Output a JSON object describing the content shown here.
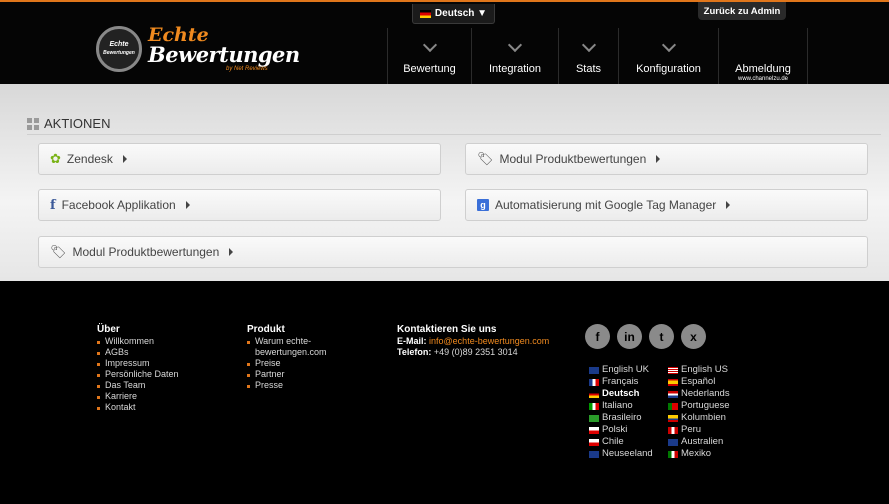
{
  "header": {
    "language_selector": "Deutsch ▼",
    "admin_button": "Zurück zu Admin",
    "logo": {
      "line1": "Echte",
      "line2": "Bewertungen",
      "by": "by Net Reviews",
      "badge_line1": "Echte",
      "badge_line2": "Bewertungen"
    },
    "nav": [
      {
        "label": "Bewertung",
        "icon": "chevron-down-icon"
      },
      {
        "label": "Integration",
        "icon": "chevron-down-icon"
      },
      {
        "label": "Stats",
        "icon": "chevron-down-icon"
      },
      {
        "label": "Konfiguration",
        "icon": "chevron-down-icon"
      },
      {
        "label": "Abmeldung",
        "sub": "www.channelzu.de"
      }
    ]
  },
  "main": {
    "section_title": "AKTIONEN",
    "actions": [
      {
        "label": "Zendesk",
        "icon": "zendesk-gear-icon"
      },
      {
        "label": "Modul Produktbewertungen",
        "icon": "tag-icon"
      },
      {
        "label": "Facebook Applikation",
        "icon": "facebook-icon"
      },
      {
        "label": "Automatisierung mit Google Tag Manager",
        "icon": "google-icon"
      },
      {
        "label": "Modul Produktbewertungen",
        "icon": "tag-icon"
      }
    ]
  },
  "footer": {
    "about": {
      "title": "Über",
      "items": [
        "Willkommen",
        "AGBs",
        "Impressum",
        "Persönliche Daten",
        "Das Team",
        "Karriere",
        "Kontakt"
      ]
    },
    "product": {
      "title": "Produkt",
      "items": [
        "Warum echte-bewertungen.com",
        "Preise",
        "Partner",
        "Presse"
      ]
    },
    "contact": {
      "title": "Kontaktieren Sie uns",
      "email_label": "E-Mail:",
      "email": "info@echte-bewertungen.com",
      "phone_label": "Telefon:",
      "phone": "+49 (0)89 2351 3014"
    },
    "socials": [
      {
        "icon": "facebook-icon",
        "glyph": "f"
      },
      {
        "icon": "linkedin-icon",
        "glyph": "in"
      },
      {
        "icon": "twitter-icon",
        "glyph": "t"
      },
      {
        "icon": "xing-icon",
        "glyph": "x"
      }
    ],
    "languages_left": [
      "English UK",
      "Français",
      "Deutsch",
      "Italiano",
      "Brasileiro",
      "Polski",
      "Chile",
      "Neuseeland"
    ],
    "languages_right": [
      "English US",
      "Español",
      "Nederlands",
      "Portuguese",
      "Kolumbien",
      "Peru",
      "Australien",
      "Mexiko"
    ],
    "active_language": "Deutsch",
    "accent_color": "#e0761b"
  }
}
